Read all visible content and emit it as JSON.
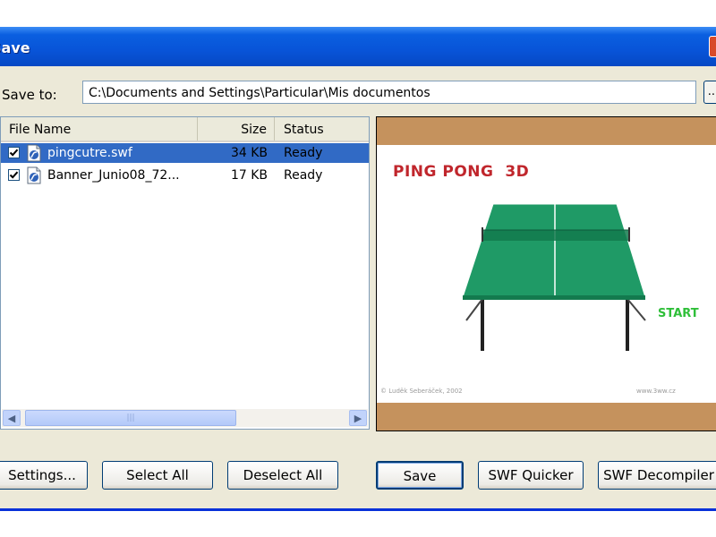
{
  "window": {
    "title": "Save",
    "close_glyph": "✕"
  },
  "save_to": {
    "label": "Save to:",
    "path": "C:\\Documents and Settings\\Particular\\Mis documentos",
    "browse_label": "..."
  },
  "file_list": {
    "columns": [
      "File Name",
      "Size",
      "Status"
    ],
    "rows": [
      {
        "checked": true,
        "name": "pingcutre.swf",
        "size": "34 KB",
        "status": "Ready",
        "selected": true
      },
      {
        "checked": true,
        "name": "Banner_Junio08_72...",
        "size": "17 KB",
        "status": "Ready",
        "selected": false
      }
    ],
    "scroll_thumb_grip": "|||"
  },
  "preview": {
    "game_title": "PING PONG  3D",
    "start_label": "START",
    "copyright": "© Luděk Seberáček, 2002",
    "website": "www.3ww.cz",
    "colors": {
      "border": "#c5925d",
      "table": "#1f9a66",
      "title": "#c0262c",
      "start": "#2fbf39"
    }
  },
  "buttons": {
    "settings": "Settings...",
    "select_all": "Select All",
    "deselect_all": "Deselect All",
    "save": "Save",
    "swf_quicker": "SWF Quicker",
    "swf_decompiler": "SWF Decompiler"
  }
}
